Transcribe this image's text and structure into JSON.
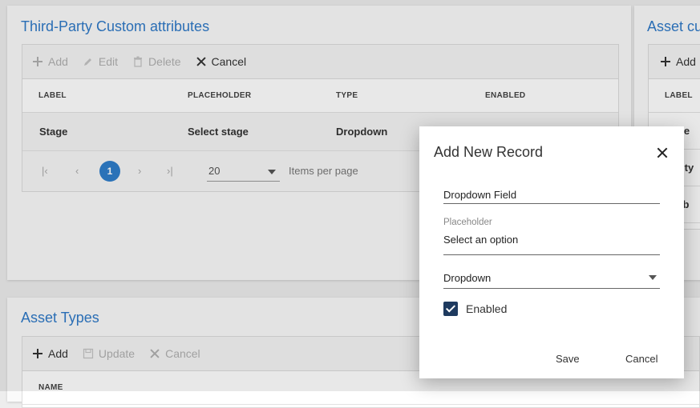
{
  "custom_attributes": {
    "title": "Third-Party Custom attributes",
    "toolbar": {
      "add": "Add",
      "edit": "Edit",
      "delete": "Delete",
      "cancel": "Cancel"
    },
    "columns": [
      "LABEL",
      "PLACEHOLDER",
      "TYPE",
      "ENABLED"
    ],
    "rows": [
      {
        "label": "Stage",
        "placeholder": "Select stage",
        "type": "Dropdown"
      }
    ],
    "pager": {
      "first": "|‹",
      "prev": "‹",
      "page": "1",
      "next": "›",
      "last": "›|",
      "page_size": "20",
      "items_per_page": "Items per page"
    }
  },
  "asset_custom": {
    "title": "Asset cu",
    "toolbar": {
      "add": "Add"
    },
    "columns": [
      "LABEL"
    ],
    "rows": [
      "fide",
      "grity",
      "ilab"
    ]
  },
  "asset_types": {
    "title": "Asset Types",
    "toolbar": {
      "add": "Add",
      "update": "Update",
      "cancel": "Cancel"
    },
    "columns": [
      "NAME"
    ]
  },
  "dialog": {
    "title": "Add New Record",
    "label_field_value": "Dropdown Field",
    "placeholder_label": "Placeholder",
    "placeholder_value": "Select an option",
    "type_value": "Dropdown",
    "enabled_label": "Enabled",
    "enabled": true,
    "save": "Save",
    "cancel": "Cancel"
  },
  "colors": {
    "accent": "#2f79c7",
    "checkbox": "#1e3a5f",
    "page_active": "#2f7ecb"
  }
}
